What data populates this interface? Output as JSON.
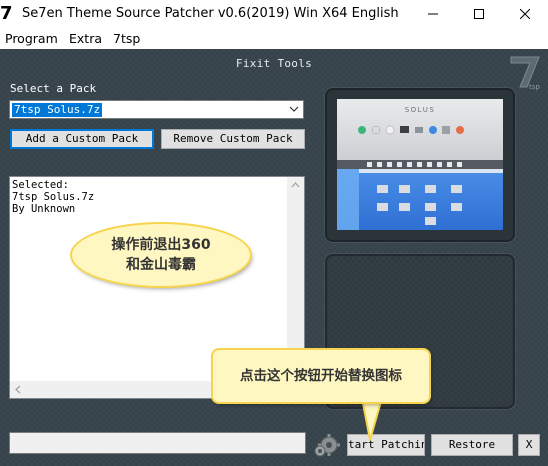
{
  "window": {
    "icon_text": "7",
    "title": "Se7en Theme Source Patcher v0.6(2019) Win X64 English"
  },
  "menu": [
    "Program",
    "Extra",
    "7tsp"
  ],
  "header": {
    "fixit": "Fixit Tools"
  },
  "pack": {
    "label": "Select a Pack",
    "selected": "7tsp Solus.7z",
    "add_button": "Add a Custom Pack",
    "remove_button": "Remove Custom Pack"
  },
  "info": {
    "line1": "Selected:",
    "line2": "7tsp Solus.7z",
    "line3": "By Unknown"
  },
  "preview": {
    "brand": "SOLUS"
  },
  "actions": {
    "start": "tart Patchin",
    "restore": "Restore",
    "close": "X"
  },
  "annotations": {
    "note1_line1": "操作前退出360",
    "note1_line2": "和金山毒霸",
    "note2": "点击这个按钮开始替换图标"
  },
  "colors": {
    "client_bg": "#36434b",
    "accent": "#0078d7",
    "callout_bg": "#fff7c2",
    "callout_border": "#f6d44e"
  }
}
